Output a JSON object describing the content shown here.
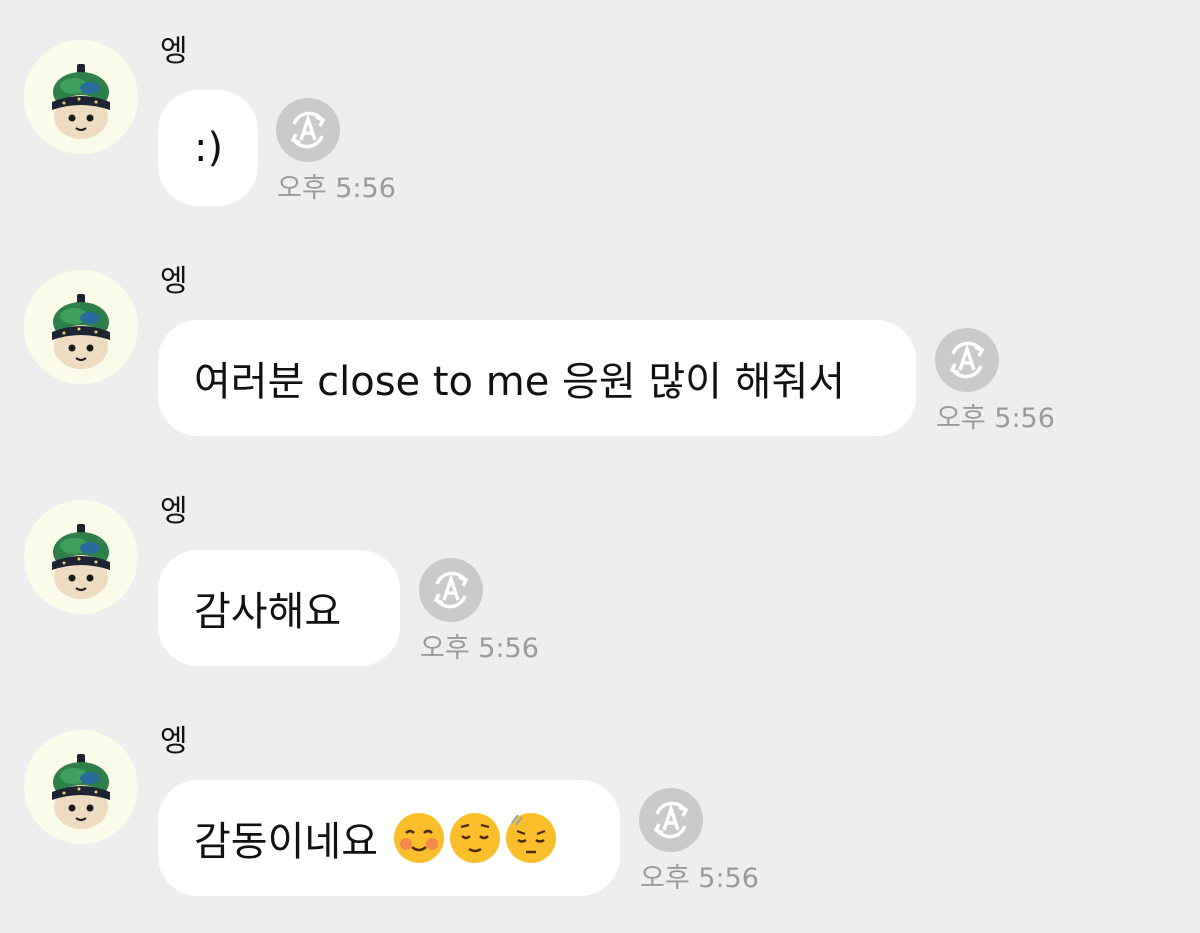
{
  "messages": [
    {
      "sender": "엥",
      "text": ":)",
      "time": "오후 5:56",
      "translate_icon": "auto-translate-icon"
    },
    {
      "sender": "엥",
      "text": "여러분 close to me 응원 많이 해줘서",
      "time": "오후 5:56",
      "translate_icon": "auto-translate-icon"
    },
    {
      "sender": "엥",
      "text": "감사해요",
      "time": "오후 5:56",
      "translate_icon": "auto-translate-icon"
    },
    {
      "sender": "엥",
      "text": "감동이네요",
      "emojis": [
        "smiling-face-blushing-icon",
        "relieved-face-icon",
        "pensive-face-icon"
      ],
      "time": "오후 5:56",
      "translate_icon": "auto-translate-icon"
    }
  ],
  "colors": {
    "background": "#eeeeee",
    "bubble": "#ffffff",
    "translate_button": "#c9c9c9",
    "timestamp": "#9a9a9a",
    "avatar_bg": "#fbfbea"
  }
}
